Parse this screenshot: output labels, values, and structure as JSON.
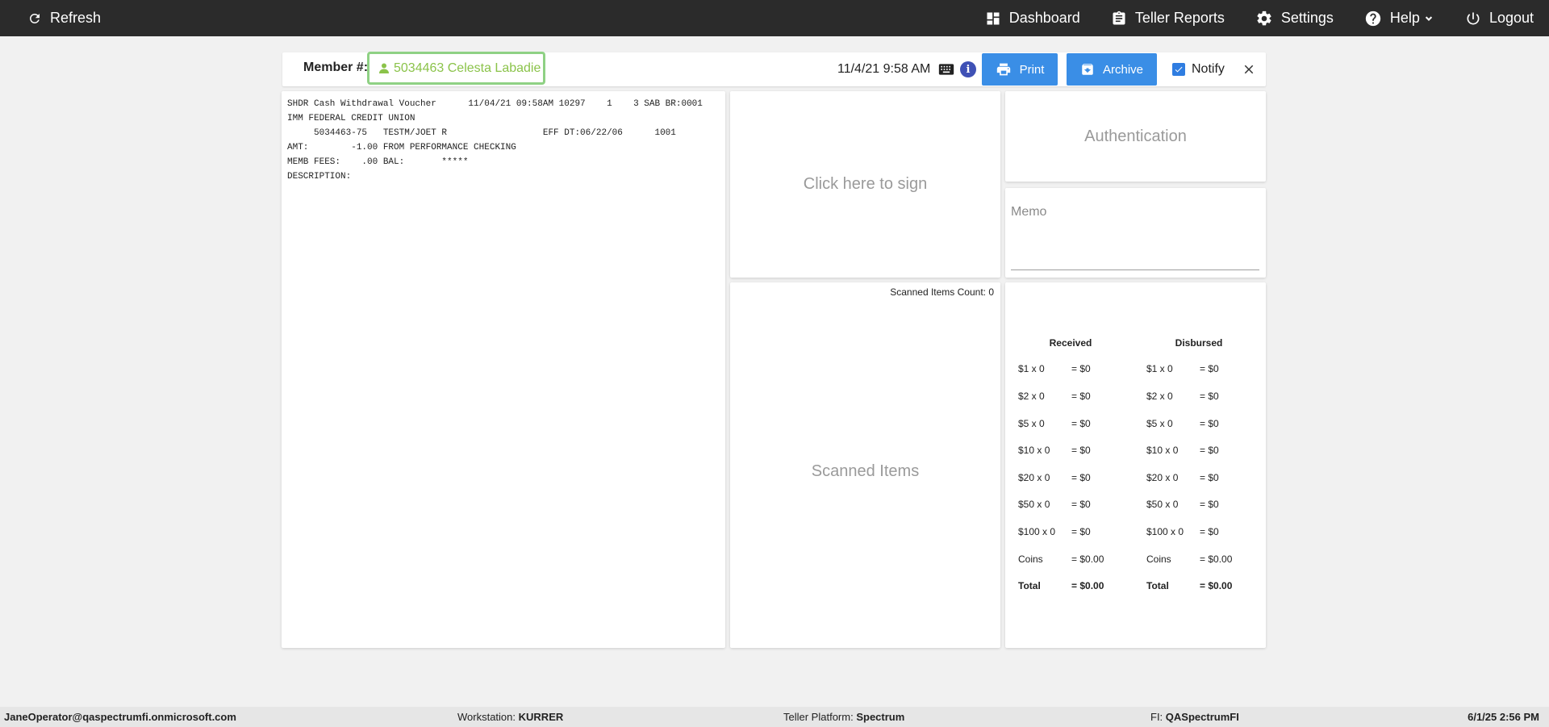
{
  "nav": {
    "refresh": "Refresh",
    "dashboard": "Dashboard",
    "teller_reports": "Teller Reports",
    "settings": "Settings",
    "help": "Help",
    "logout": "Logout"
  },
  "member": {
    "label": "Member #:",
    "value": "5034463 Celesta Labadie"
  },
  "header": {
    "datetime": "11/4/21 9:58 AM",
    "print_label": "Print",
    "archive_label": "Archive",
    "notify_label": "Notify",
    "notify_checked": true
  },
  "receipt": {
    "text": "SHDR Cash Withdrawal Voucher      11/04/21 09:58AM 10297    1    3 SAB BR:0001\nIMM FEDERAL CREDIT UNION\n     5034463-75   TESTM/JOET R                  EFF DT:06/22/06      1001\nAMT:        -1.00 FROM PERFORMANCE CHECKING\nMEMB FEES:    .00 BAL:       *****\nDESCRIPTION:"
  },
  "signature": {
    "label": "Click here to sign"
  },
  "scanned": {
    "count_label": "Scanned Items Count: 0",
    "title": "Scanned Items"
  },
  "authentication": {
    "label": "Authentication"
  },
  "memo": {
    "label": "Memo"
  },
  "cash": {
    "received": {
      "header": "Received",
      "rows": [
        {
          "label": "$1 x 0",
          "value": "= $0"
        },
        {
          "label": "$2 x 0",
          "value": "= $0"
        },
        {
          "label": "$5 x 0",
          "value": "= $0"
        },
        {
          "label": "$10 x 0",
          "value": "= $0"
        },
        {
          "label": "$20 x 0",
          "value": "= $0"
        },
        {
          "label": "$50 x 0",
          "value": "= $0"
        },
        {
          "label": "$100 x 0",
          "value": "= $0"
        },
        {
          "label": "Coins",
          "value": "= $0.00"
        },
        {
          "label": "Total",
          "value": "= $0.00"
        }
      ]
    },
    "disbursed": {
      "header": "Disbursed",
      "rows": [
        {
          "label": "$1 x 0",
          "value": "= $0"
        },
        {
          "label": "$2 x 0",
          "value": "= $0"
        },
        {
          "label": "$5 x 0",
          "value": "= $0"
        },
        {
          "label": "$10 x 0",
          "value": "= $0"
        },
        {
          "label": "$20 x 0",
          "value": "= $0"
        },
        {
          "label": "$50 x 0",
          "value": "= $0"
        },
        {
          "label": "$100 x 0",
          "value": "= $0"
        },
        {
          "label": "Coins",
          "value": "= $0.00"
        },
        {
          "label": "Total",
          "value": "= $0.00"
        }
      ]
    }
  },
  "status": {
    "user": "JaneOperator@qaspectrumfi.onmicrosoft.com",
    "workstation_label": "Workstation:",
    "workstation": "KURRER",
    "platform_label": "Teller Platform:",
    "platform": "Spectrum",
    "fi_label": "FI:",
    "fi": "QASpectrumFI",
    "datetime": "6/1/25 2:56 PM"
  },
  "colors": {
    "topbar": "#2b2b2b",
    "accent_blue": "#3a8ee6",
    "member_green": "#8bc34a",
    "info_indigo": "#3f51b5"
  }
}
